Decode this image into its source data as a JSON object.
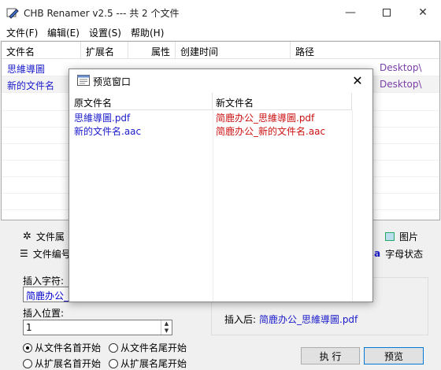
{
  "window": {
    "title": "CHB Renamer v2.5 --- 共 2 个文件"
  },
  "menu": [
    "文件(F)",
    "编辑(E)",
    "设置(S)",
    "帮助(H)"
  ],
  "file_list": {
    "columns": [
      "文件名",
      "扩展名",
      "属性",
      "创建时间",
      "路径"
    ],
    "rows": [
      {
        "name": "思維導圖",
        "ext": "",
        "attr": "",
        "time": "",
        "path": "Desktop\\"
      },
      {
        "name": "新的文件名",
        "ext": "",
        "attr": "",
        "time": "",
        "path": "Desktop\\"
      }
    ]
  },
  "tabs": {
    "attr_tab": "文件属",
    "number_tab": "文件编号",
    "image_tab": "图片",
    "letter_tab": "字母状态",
    "letter_icon": "a"
  },
  "panel": {
    "insert_char_label": "插入字符:",
    "insert_char_value": "简鹿办公_",
    "insert_pos_label": "插入位置:",
    "insert_pos_value": "1",
    "after_label": "插入后:",
    "after_value": "简鹿办公_思維導圖.pdf",
    "radios": [
      "从文件名首开始",
      "从文件名尾开始",
      "从扩展名首开始",
      "从扩展名尾开始"
    ],
    "run_button": "执 行",
    "preview_button": "预览"
  },
  "preview_dialog": {
    "title": "预览窗口",
    "close_glyph": "✕",
    "columns": [
      "原文件名",
      "新文件名"
    ],
    "rows": [
      {
        "original": "思維導圖.pdf",
        "new": "简鹿办公_思維導圖.pdf"
      },
      {
        "original": "新的文件名.aac",
        "new": "简鹿办公_新的文件名.aac"
      }
    ]
  },
  "icons": {
    "app": "rename-icon",
    "min": "minimize-icon",
    "max": "maximize-icon",
    "close": "close-icon"
  },
  "colors": {
    "original_text": "#1a1acc",
    "new_text": "#cc1111",
    "path_text": "#7a3fa8"
  }
}
